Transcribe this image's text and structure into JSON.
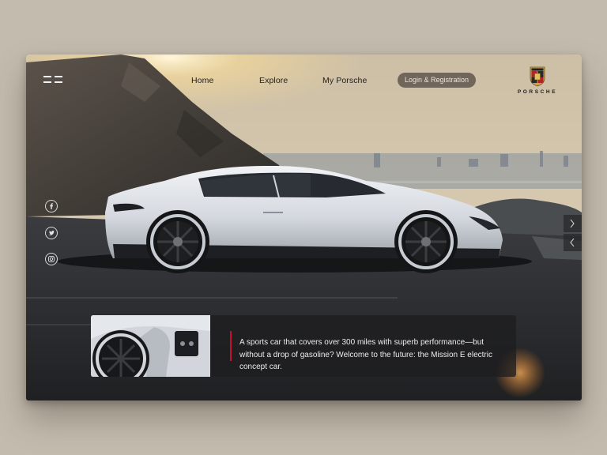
{
  "nav": {
    "menu_icon": "hamburger-icon",
    "items": [
      {
        "label": "Home"
      },
      {
        "label": "Explore"
      },
      {
        "label": "My Porsche"
      }
    ],
    "login_label": "Login & Registration"
  },
  "brand": {
    "crest_icon": "porsche-crest-icon",
    "name": "PORSCHE"
  },
  "social": [
    {
      "icon": "facebook-icon"
    },
    {
      "icon": "twitter-icon"
    },
    {
      "icon": "instagram-icon"
    }
  ],
  "slider": {
    "next_icon": "chevron-right-icon",
    "prev_icon": "chevron-left-icon"
  },
  "info": {
    "text": "A sports car that covers over 300 miles with superb performance—but without a drop of gasoline? Welcome to the future: the Mission E electric concept car."
  },
  "colors": {
    "page_background": "#c3bbad",
    "accent_red": "#c8102e",
    "car_body": "#dfe3e8",
    "login_pill": "#5f564c"
  }
}
